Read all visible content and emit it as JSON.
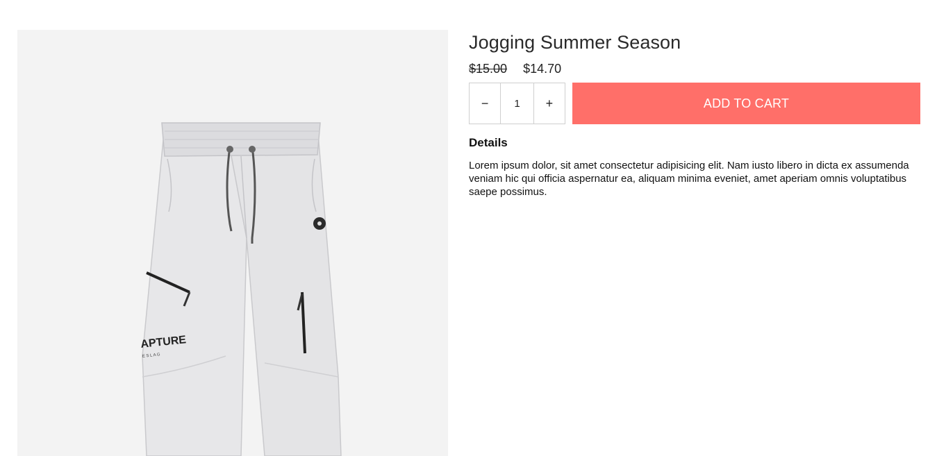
{
  "product": {
    "title": "Jogging Summer Season",
    "price_original": "$15.00",
    "price_sale": "$14.70",
    "image_brand_text": "APTURE",
    "image_brand_subtext": "E  S L A G"
  },
  "quantity": {
    "decrement_label": "−",
    "value": "1",
    "increment_label": "+"
  },
  "actions": {
    "add_to_cart_label": "ADD TO CART"
  },
  "details": {
    "heading": "Details",
    "body": "Lorem ipsum dolor, sit amet consectetur adipisicing elit. Nam iusto libero in dicta ex assumenda veniam hic qui officia aspernatur ea, aliquam minima eveniet, amet aperiam omnis voluptatibus saepe possimus."
  },
  "colors": {
    "accent": "#ff6f69",
    "image_background": "#f3f3f3"
  }
}
